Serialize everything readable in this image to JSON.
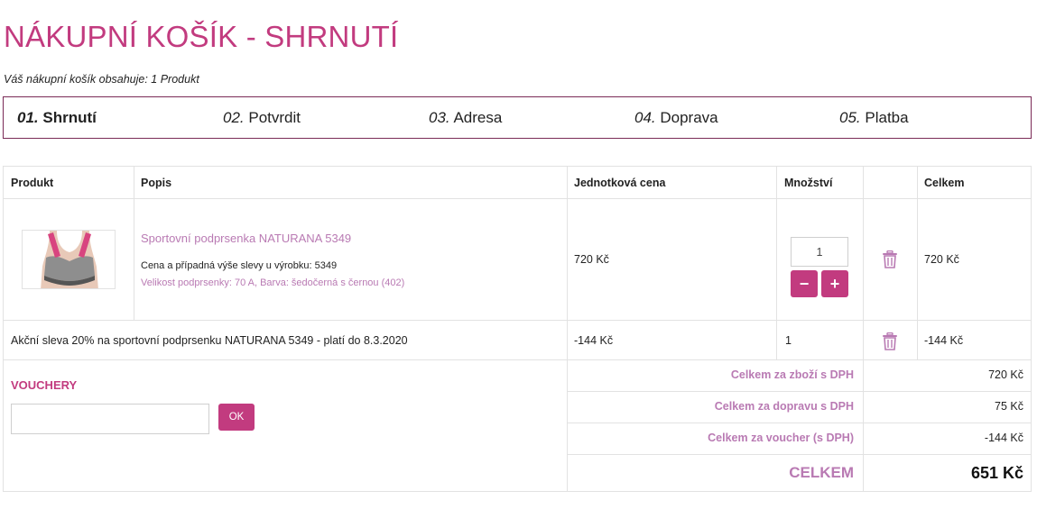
{
  "page": {
    "title": "NÁKUPNÍ KOŠÍK - SHRNUTÍ",
    "cart_summary": "Váš nákupní košík obsahuje: 1 Produkt"
  },
  "steps": [
    {
      "num": "01.",
      "label": "Shrnutí",
      "active": true
    },
    {
      "num": "02.",
      "label": "Potvrdit",
      "active": false
    },
    {
      "num": "03.",
      "label": "Adresa",
      "active": false
    },
    {
      "num": "04.",
      "label": "Doprava",
      "active": false
    },
    {
      "num": "05.",
      "label": "Platba",
      "active": false
    }
  ],
  "table": {
    "headers": {
      "product": "Produkt",
      "description": "Popis",
      "unit_price": "Jednotková cena",
      "quantity": "Množství",
      "total": "Celkem"
    },
    "item": {
      "name": "Sportovní podprsenka NATURANA 5349",
      "price_note": "Cena a případná výše slevy u výrobku: 5349",
      "variant": "Velikost podprsenky: 70 A, Barva: šedočerná s černou (402)",
      "unit_price": "720 Kč",
      "quantity": "1",
      "total": "720 Kč",
      "minus_label": "−",
      "plus_label": "+"
    },
    "discount": {
      "description": "Akční sleva 20% na sportovní podprsenku NATURANA 5349 - platí do 8.3.2020",
      "unit_price": "-144 Kč",
      "quantity": "1",
      "total": "-144 Kč"
    }
  },
  "voucher": {
    "title": "VOUCHERY",
    "input_value": "",
    "ok_label": "OK"
  },
  "totals": {
    "goods_label": "Celkem za zboží s DPH",
    "goods_value": "720 Kč",
    "shipping_label": "Celkem za dopravu s DPH",
    "shipping_value": "75 Kč",
    "voucher_label": "Celkem za voucher (s DPH)",
    "voucher_value": "-144 Kč",
    "grand_label": "CELKEM",
    "grand_value": "651 Kč"
  },
  "colors": {
    "accent": "#c23b7f",
    "link": "#b97ab3",
    "border": "#e2e2e2"
  }
}
